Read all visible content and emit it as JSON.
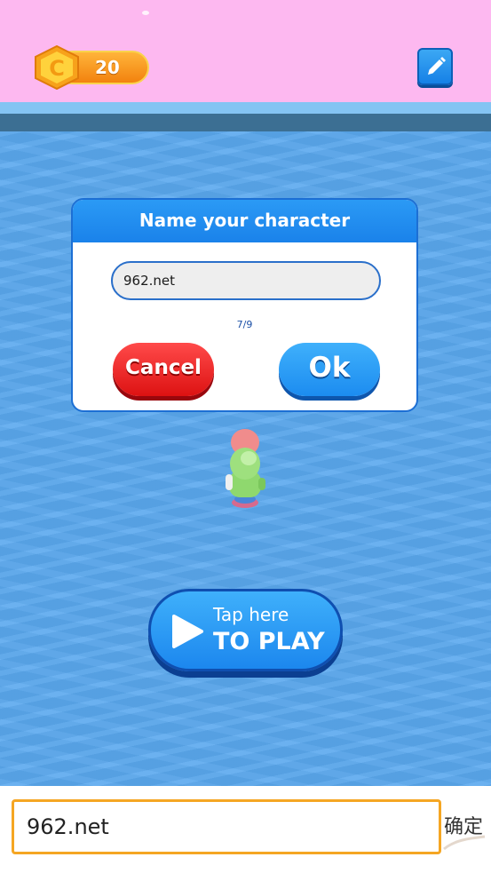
{
  "header": {
    "coins": "20",
    "coin_icon_letter": "C",
    "icons": {
      "coin": "coin-icon",
      "edit": "pencil-icon"
    }
  },
  "dialog": {
    "title": "Name your character",
    "name_value": "962.net",
    "char_count": "7/9",
    "cancel_label": "Cancel",
    "ok_label": "Ok"
  },
  "play": {
    "line1": "Tap here",
    "line2": "TO PLAY",
    "icon": "play-icon"
  },
  "ime": {
    "input_value": "962.net",
    "confirm_label": "确定"
  },
  "colors": {
    "header_bg": "#fdb8f0",
    "water": "#5aa8ee",
    "dialog_accent": "#1a82ea",
    "cancel_red": "#e31b1b",
    "ok_blue": "#1c8cf0",
    "ime_border": "#f5a623"
  }
}
